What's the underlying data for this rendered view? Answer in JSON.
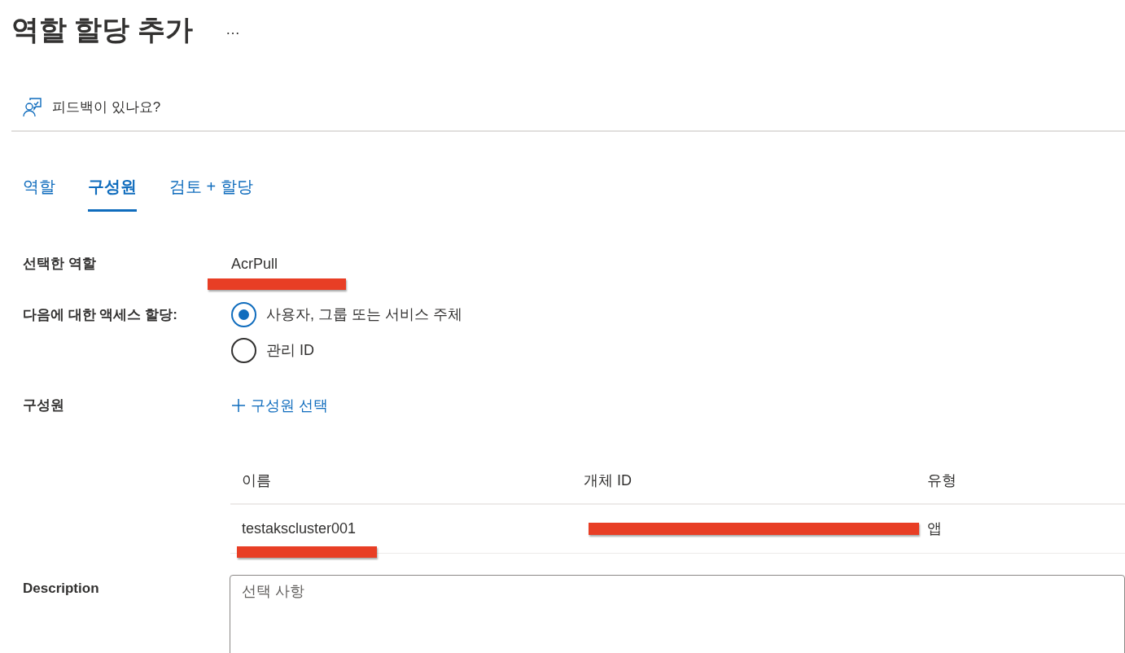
{
  "header": {
    "title": "역할 할당 추가",
    "more": "…"
  },
  "feedback": {
    "label": "피드백이 있나요?"
  },
  "tabs": [
    {
      "label": "역할",
      "selected": false
    },
    {
      "label": "구성원",
      "selected": true
    },
    {
      "label": "검토 + 할당",
      "selected": false
    }
  ],
  "selected_role": {
    "label": "선택한 역할",
    "value": "AcrPull"
  },
  "assign_access": {
    "label": "다음에 대한 액세스 할당:",
    "options": [
      {
        "label": "사용자, 그룹 또는 서비스 주체",
        "selected": true
      },
      {
        "label": "관리 ID",
        "selected": false
      }
    ]
  },
  "members": {
    "label": "구성원",
    "action": "구성원 선택",
    "table": {
      "columns": [
        "이름",
        "개체 ID",
        "유형"
      ],
      "rows": [
        {
          "name": "testakscluster001",
          "type": "앱"
        }
      ]
    }
  },
  "description": {
    "label": "Description",
    "placeholder": "선택 사항"
  }
}
